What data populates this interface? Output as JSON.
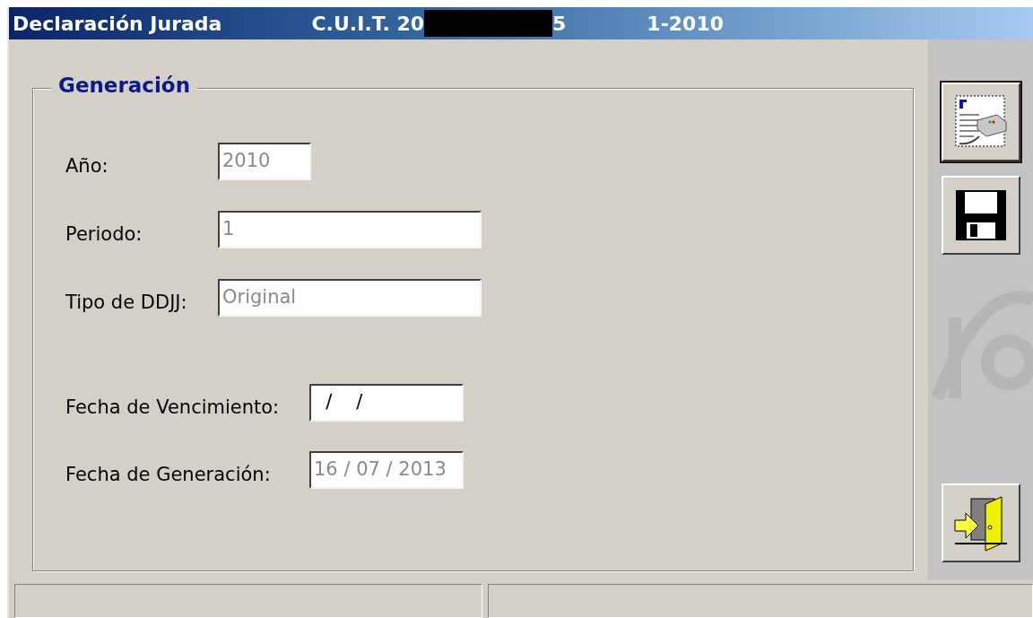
{
  "window": {
    "title_parts": [
      {
        "kind": "text",
        "text": "Declaración Jurada"
      },
      {
        "kind": "text",
        "text": "C.U.I.T. 20"
      },
      {
        "kind": "redacted"
      },
      {
        "kind": "text",
        "text": "5"
      },
      {
        "kind": "text",
        "text": "1-2010"
      }
    ]
  },
  "group": {
    "title": "Generación",
    "fields": [
      {
        "label": "Año:",
        "value": "2010",
        "disabled": true,
        "kind": "year"
      },
      {
        "label": "Periodo:",
        "value": "1",
        "disabled": true,
        "kind": "text"
      },
      {
        "label": "Tipo de DDJJ:",
        "value": "Original",
        "disabled": true,
        "kind": "text"
      }
    ],
    "date_fields": [
      {
        "label": "Fecha de Vencimiento:",
        "value": "  /    /",
        "disabled": false
      },
      {
        "label": "Fecha de Generación:",
        "value": "16 / 07 / 2013",
        "disabled": true
      }
    ]
  },
  "toolbar": [
    {
      "kind": "print",
      "default": true
    },
    {
      "kind": "save",
      "default": false
    },
    {
      "kind": "exit",
      "default": false
    }
  ]
}
